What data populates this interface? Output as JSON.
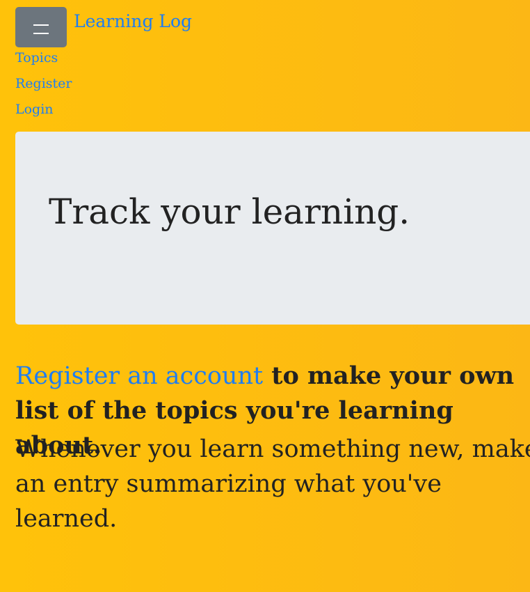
{
  "colors": {
    "background_start": "#ffc20a",
    "background_end": "#fcb715",
    "link": "#1e7df2",
    "toggler": "#6c757d",
    "jumbotron": "#e9ecef",
    "text": "#222222"
  },
  "navbar": {
    "toggler_icon": "hamburger-menu-icon",
    "brand": "Learning Log",
    "links": [
      {
        "label": "Topics"
      },
      {
        "label": "Register"
      },
      {
        "label": "Login"
      }
    ]
  },
  "jumbotron": {
    "heading": "Track your learning."
  },
  "intro": {
    "register_link": "Register an account",
    "line1_rest": " to make your own list of the topics you're learning about.",
    "line2": "Whenever you learn something new, make an entry summarizing what you've learned."
  }
}
